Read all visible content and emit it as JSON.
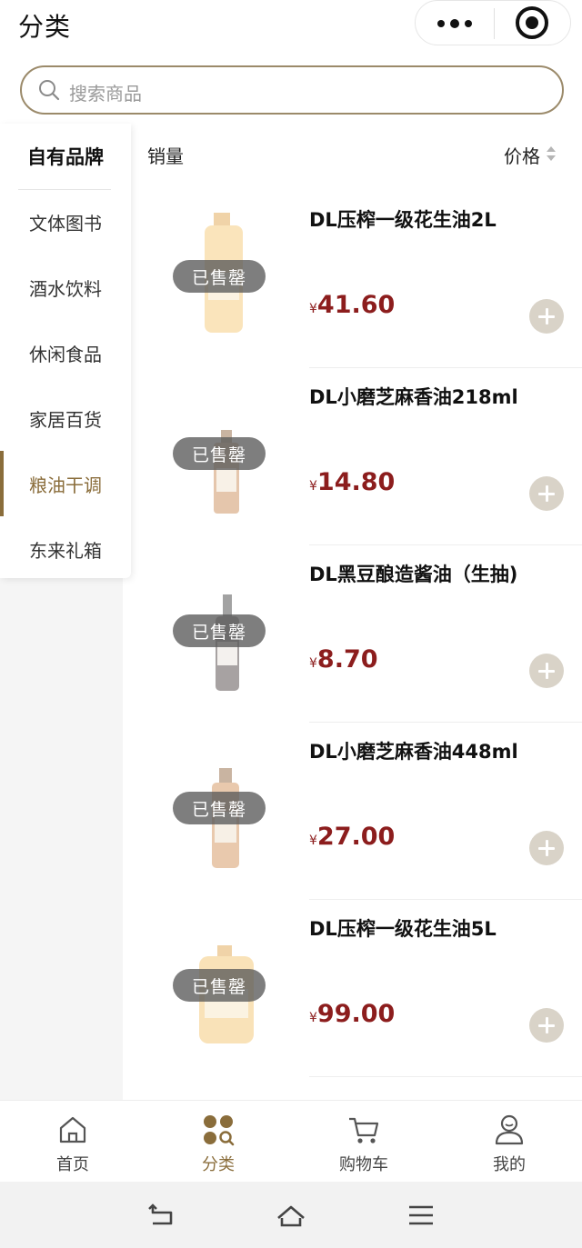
{
  "header": {
    "title": "分类",
    "more_icon": "more-dots-icon",
    "close_icon": "target-close-icon"
  },
  "search": {
    "placeholder": "搜索商品",
    "icon": "search-icon",
    "border_color": "#9b8a6a"
  },
  "sidebar": {
    "items": [
      {
        "label": "自有品牌"
      },
      {
        "label": "文体图书"
      },
      {
        "label": "酒水饮料"
      },
      {
        "label": "休闲食品"
      },
      {
        "label": "家居百货"
      },
      {
        "label": "粮油干调"
      },
      {
        "label": "东来礼箱"
      }
    ],
    "active_label": "粮油干调",
    "accent_color": "#8a6d3b"
  },
  "sort": {
    "sales_label": "销量",
    "price_label": "价格"
  },
  "products": [
    {
      "name": "DL压榨一级花生油2L",
      "currency": "¥",
      "price": "41.60",
      "status": "已售罄"
    },
    {
      "name": "DL小磨芝麻香油218ml",
      "currency": "¥",
      "price": "14.80",
      "status": "已售罄"
    },
    {
      "name": "DL黑豆酿造酱油（生抽)",
      "currency": "¥",
      "price": "8.70",
      "status": "已售罄"
    },
    {
      "name": "DL小磨芝麻香油448ml",
      "currency": "¥",
      "price": "27.00",
      "status": "已售罄"
    },
    {
      "name": "DL压榨一级花生油5L",
      "currency": "¥",
      "price": "99.00",
      "status": "已售罄"
    }
  ],
  "price_color": "#8c1d1d",
  "tabbar": {
    "tabs": [
      {
        "label": "首页",
        "icon": "home-icon"
      },
      {
        "label": "分类",
        "icon": "category-icon"
      },
      {
        "label": "购物车",
        "icon": "cart-icon"
      },
      {
        "label": "我的",
        "icon": "profile-icon"
      }
    ],
    "active_index": 1
  },
  "system_nav": {
    "buttons": [
      "back-icon",
      "home-nav-icon",
      "menu-icon"
    ]
  }
}
